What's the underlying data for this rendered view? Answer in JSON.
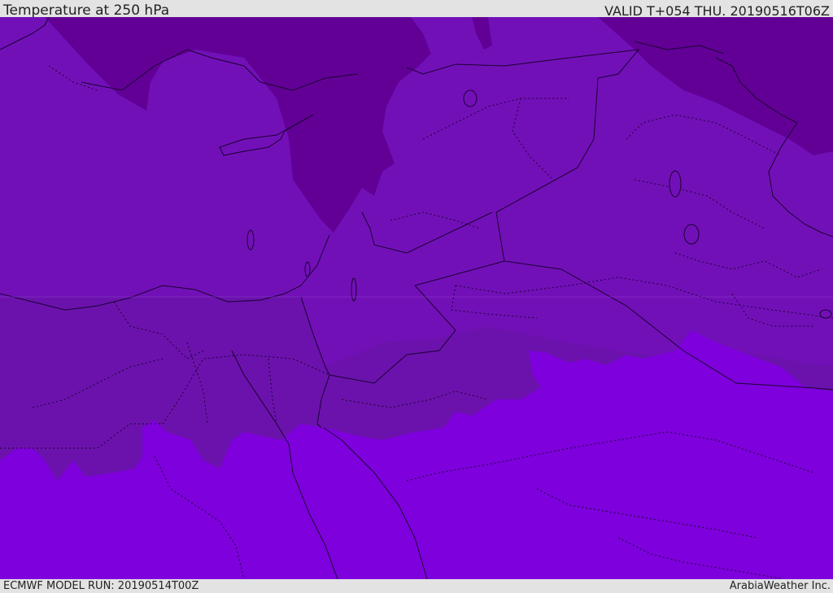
{
  "header": {
    "title": "Temperature at 250 hPa",
    "valid_time": "VALID T+054 THU. 20190516T06Z"
  },
  "footer": {
    "model_run": "ECMWF MODEL RUN: 20190514T00Z",
    "credit": "ArabiaWeather Inc."
  },
  "map": {
    "field": "temperature",
    "level": "250 hPa",
    "fill_colors": {
      "coldest": "#620096",
      "cold": "#7210b8",
      "mid": "#6b12ac",
      "warm": "#7e00dc"
    },
    "border_color": "#1a0030"
  }
}
